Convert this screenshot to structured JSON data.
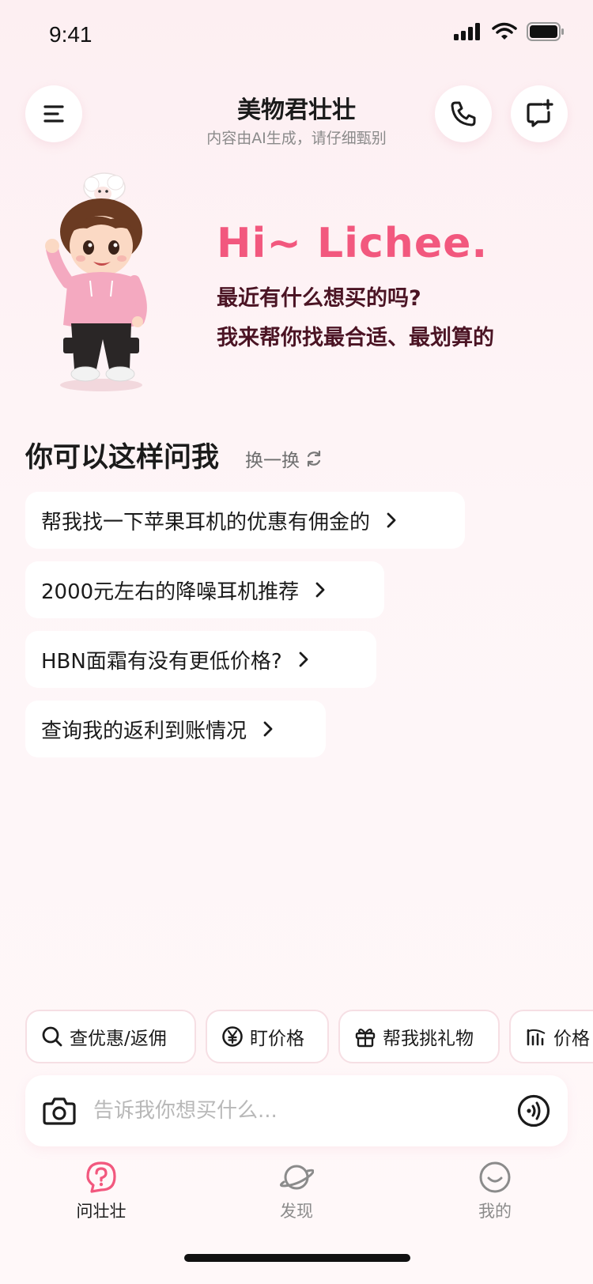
{
  "status_bar": {
    "time": "9:41"
  },
  "header": {
    "title": "美物君壮壮",
    "subtitle": "内容由AI生成，请仔细甄别",
    "icons": {
      "menu": "menu-icon",
      "phone": "phone-icon",
      "new_chat": "new-chat-icon"
    }
  },
  "greeting": {
    "hi": "Hi~ Lichee.",
    "line1": "最近有什么想买的吗?",
    "line2": "我来帮你找最合适、最划算的"
  },
  "suggestions": {
    "title": "你可以这样问我",
    "refresh_label": "换一换",
    "items": [
      "帮我找一下苹果耳机的优惠有佣金的",
      "2000元左右的降噪耳机推荐",
      "HBN面霜有没有更低价格?",
      "查询我的返利到账情况"
    ]
  },
  "chips": [
    {
      "label": "查优惠/返佣",
      "icon": "search-icon"
    },
    {
      "label": "盯价格",
      "icon": "yen-icon"
    },
    {
      "label": "帮我挑礼物",
      "icon": "gift-icon"
    },
    {
      "label": "价格",
      "icon": "price-chart-icon"
    }
  ],
  "input": {
    "placeholder": "告诉我你想买什么...",
    "icons": {
      "camera": "camera-icon",
      "voice": "voice-icon"
    }
  },
  "tabs": [
    {
      "label": "问壮壮",
      "icon": "question-icon",
      "active": true
    },
    {
      "label": "发现",
      "icon": "planet-icon",
      "active": false
    },
    {
      "label": "我的",
      "icon": "smile-icon",
      "active": false
    }
  ],
  "colors": {
    "accent": "#f2587e",
    "greeting_text": "#4b1424",
    "background": "#fdeff2"
  }
}
